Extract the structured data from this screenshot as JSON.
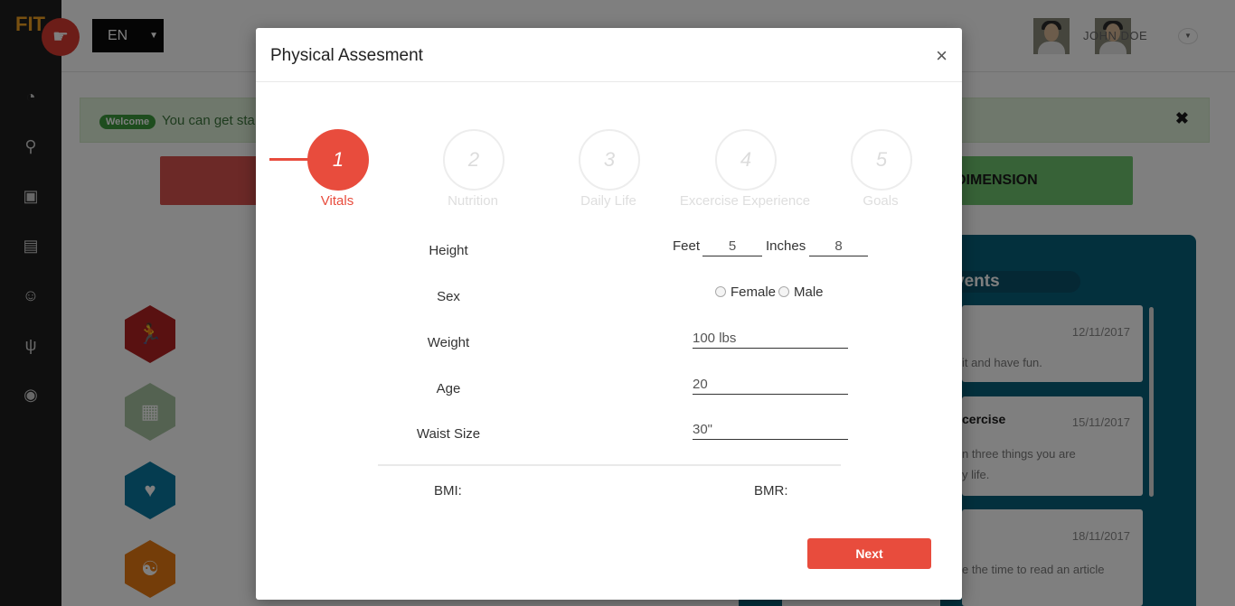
{
  "app": {
    "brand": "FIT"
  },
  "header": {
    "language": "EN",
    "user_name": "JOHN DOE"
  },
  "alert": {
    "badge": "Welcome",
    "text": "You can get sta"
  },
  "buttons": {
    "dimension_label": "DIMENSION"
  },
  "events": {
    "title": "vents",
    "items": [
      {
        "title": "",
        "date": "12/11/2017",
        "text": "it and have fun."
      },
      {
        "title": "cercise",
        "date": "15/11/2017",
        "text_1": "n three things you are",
        "text_2": "y life."
      },
      {
        "title": "",
        "date": "18/11/2017",
        "text": "e the time to read an article"
      }
    ]
  },
  "modal": {
    "title": "Physical Assesment",
    "close": "×",
    "steps": [
      {
        "number": "1",
        "label": "Vitals",
        "active": true
      },
      {
        "number": "2",
        "label": "Nutrition",
        "active": false
      },
      {
        "number": "3",
        "label": "Daily Life",
        "active": false
      },
      {
        "number": "4",
        "label": "Excercise Experience",
        "active": false
      },
      {
        "number": "5",
        "label": "Goals",
        "active": false
      }
    ],
    "fields": {
      "height": {
        "label": "Height",
        "feet_label": "Feet",
        "feet_value": "5",
        "inches_label": "Inches",
        "inches_value": "8"
      },
      "sex": {
        "label": "Sex",
        "options": [
          "Female",
          "Male"
        ]
      },
      "weight": {
        "label": "Weight",
        "value": "100 lbs"
      },
      "age": {
        "label": "Age",
        "value": "20"
      },
      "waist": {
        "label": "Waist Size",
        "value": "30\""
      }
    },
    "results": {
      "bmi_label": "BMI:",
      "bmr_label": "BMR:"
    },
    "next_label": "Next"
  },
  "colors": {
    "accent": "#e84c3d",
    "sidebar": "#1f1f1f",
    "events_panel": "#07607b",
    "alert_bg": "#dff0d8"
  },
  "icons": {
    "sidebar": [
      "dashboard-icon",
      "bicycle-icon",
      "money-icon",
      "book-icon",
      "smile-icon",
      "utensils-icon",
      "target-icon"
    ],
    "hexagons": [
      "runner-icon",
      "calculator-icon",
      "heart-plus-icon",
      "mind-icon"
    ]
  }
}
